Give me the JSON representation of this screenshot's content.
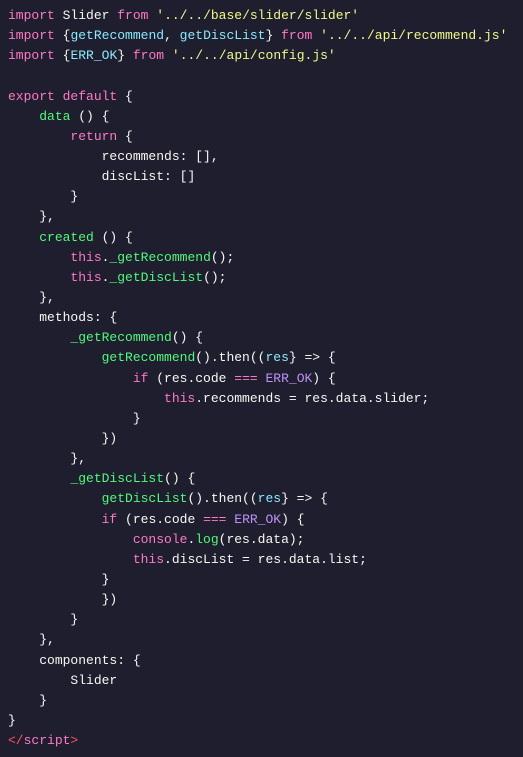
{
  "code": {
    "lines": [
      {
        "id": 1,
        "tokens": [
          {
            "t": "import-kw",
            "v": "import"
          },
          {
            "t": "plain",
            "v": " Slider "
          },
          {
            "t": "from-kw",
            "v": "from"
          },
          {
            "t": "plain",
            "v": " "
          },
          {
            "t": "string",
            "v": "'../../base/slider/slider'"
          }
        ]
      },
      {
        "id": 2,
        "tokens": [
          {
            "t": "import-kw",
            "v": "import"
          },
          {
            "t": "plain",
            "v": " "
          },
          {
            "t": "brace",
            "v": "{"
          },
          {
            "t": "cyan",
            "v": "getRecommend"
          },
          {
            "t": "plain",
            "v": ", "
          },
          {
            "t": "cyan",
            "v": "getDiscList"
          },
          {
            "t": "brace",
            "v": "}"
          },
          {
            "t": "plain",
            "v": " "
          },
          {
            "t": "from-kw",
            "v": "from"
          },
          {
            "t": "plain",
            "v": " "
          },
          {
            "t": "string",
            "v": "'../../api/recommend.js'"
          }
        ]
      },
      {
        "id": 3,
        "tokens": [
          {
            "t": "import-kw",
            "v": "import"
          },
          {
            "t": "plain",
            "v": " "
          },
          {
            "t": "brace",
            "v": "{"
          },
          {
            "t": "cyan",
            "v": "ERR_OK"
          },
          {
            "t": "brace",
            "v": "}"
          },
          {
            "t": "plain",
            "v": " "
          },
          {
            "t": "from-kw",
            "v": "from"
          },
          {
            "t": "plain",
            "v": " "
          },
          {
            "t": "string",
            "v": "'../../api/config.js'"
          }
        ]
      },
      {
        "id": 4,
        "tokens": []
      },
      {
        "id": 5,
        "tokens": [
          {
            "t": "keyword",
            "v": "export"
          },
          {
            "t": "plain",
            "v": " "
          },
          {
            "t": "keyword",
            "v": "default"
          },
          {
            "t": "plain",
            "v": " "
          },
          {
            "t": "brace",
            "v": "{"
          }
        ]
      },
      {
        "id": 6,
        "tokens": [
          {
            "t": "plain",
            "v": "    "
          },
          {
            "t": "func-name",
            "v": "data"
          },
          {
            "t": "plain",
            "v": " () "
          },
          {
            "t": "brace",
            "v": "{"
          }
        ]
      },
      {
        "id": 7,
        "tokens": [
          {
            "t": "plain",
            "v": "        "
          },
          {
            "t": "keyword",
            "v": "return"
          },
          {
            "t": "plain",
            "v": " "
          },
          {
            "t": "brace",
            "v": "{"
          }
        ]
      },
      {
        "id": 8,
        "tokens": [
          {
            "t": "plain",
            "v": "            "
          },
          {
            "t": "plain",
            "v": "recommends: "
          },
          {
            "t": "brace",
            "v": "[]"
          },
          {
            "t": "plain",
            "v": ","
          }
        ]
      },
      {
        "id": 9,
        "tokens": [
          {
            "t": "plain",
            "v": "            "
          },
          {
            "t": "plain",
            "v": "discList: "
          },
          {
            "t": "brace",
            "v": "[]"
          }
        ]
      },
      {
        "id": 10,
        "tokens": [
          {
            "t": "plain",
            "v": "        "
          },
          {
            "t": "brace",
            "v": "}"
          }
        ]
      },
      {
        "id": 11,
        "tokens": [
          {
            "t": "plain",
            "v": "    "
          },
          {
            "t": "brace",
            "v": "},"
          }
        ]
      },
      {
        "id": 12,
        "tokens": [
          {
            "t": "plain",
            "v": "    "
          },
          {
            "t": "func-name",
            "v": "created"
          },
          {
            "t": "plain",
            "v": " () "
          },
          {
            "t": "brace",
            "v": "{"
          }
        ]
      },
      {
        "id": 13,
        "tokens": [
          {
            "t": "plain",
            "v": "        "
          },
          {
            "t": "this-kw",
            "v": "this"
          },
          {
            "t": "plain",
            "v": "."
          },
          {
            "t": "method-call",
            "v": "_getRecommend"
          },
          {
            "t": "plain",
            "v": "();"
          }
        ]
      },
      {
        "id": 14,
        "tokens": [
          {
            "t": "plain",
            "v": "        "
          },
          {
            "t": "this-kw",
            "v": "this"
          },
          {
            "t": "plain",
            "v": "."
          },
          {
            "t": "method-call",
            "v": "_getDiscList"
          },
          {
            "t": "plain",
            "v": "();"
          }
        ]
      },
      {
        "id": 15,
        "tokens": [
          {
            "t": "plain",
            "v": "    "
          },
          {
            "t": "brace",
            "v": "},"
          }
        ]
      },
      {
        "id": 16,
        "tokens": [
          {
            "t": "plain",
            "v": "    "
          },
          {
            "t": "plain",
            "v": "methods: "
          },
          {
            "t": "brace",
            "v": "{"
          }
        ]
      },
      {
        "id": 17,
        "tokens": [
          {
            "t": "plain",
            "v": "        "
          },
          {
            "t": "func-name",
            "v": "_getRecommend"
          },
          {
            "t": "plain",
            "v": "() "
          },
          {
            "t": "brace",
            "v": "{"
          }
        ]
      },
      {
        "id": 18,
        "tokens": [
          {
            "t": "plain",
            "v": "            "
          },
          {
            "t": "method-call",
            "v": "getRecommend"
          },
          {
            "t": "plain",
            "v": "().then(("
          },
          {
            "t": "cyan",
            "v": "res"
          },
          {
            "t": "plain",
            "v": "} => "
          },
          {
            "t": "brace",
            "v": "{"
          }
        ]
      },
      {
        "id": 19,
        "tokens": [
          {
            "t": "plain",
            "v": "                "
          },
          {
            "t": "keyword",
            "v": "if"
          },
          {
            "t": "plain",
            "v": " (res.code "
          },
          {
            "t": "operator",
            "v": "==="
          },
          {
            "t": "plain",
            "v": " "
          },
          {
            "t": "const-val",
            "v": "ERR_OK"
          },
          {
            "t": "plain",
            "v": ") "
          },
          {
            "t": "brace",
            "v": "{"
          }
        ]
      },
      {
        "id": 20,
        "tokens": [
          {
            "t": "plain",
            "v": "                    "
          },
          {
            "t": "this-kw",
            "v": "this"
          },
          {
            "t": "plain",
            "v": ".recommends = res.data.slider;"
          }
        ]
      },
      {
        "id": 21,
        "tokens": [
          {
            "t": "plain",
            "v": "                "
          },
          {
            "t": "brace",
            "v": "}"
          }
        ]
      },
      {
        "id": 22,
        "tokens": [
          {
            "t": "plain",
            "v": "            "
          },
          {
            "t": "brace",
            "v": "})"
          }
        ]
      },
      {
        "id": 23,
        "tokens": [
          {
            "t": "plain",
            "v": "        "
          },
          {
            "t": "brace",
            "v": "},"
          }
        ]
      },
      {
        "id": 24,
        "tokens": [
          {
            "t": "plain",
            "v": "        "
          },
          {
            "t": "func-name",
            "v": "_getDiscList"
          },
          {
            "t": "plain",
            "v": "() "
          },
          {
            "t": "brace",
            "v": "{"
          }
        ]
      },
      {
        "id": 25,
        "tokens": [
          {
            "t": "plain",
            "v": "            "
          },
          {
            "t": "method-call",
            "v": "getDiscList"
          },
          {
            "t": "plain",
            "v": "().then(("
          },
          {
            "t": "cyan",
            "v": "res"
          },
          {
            "t": "plain",
            "v": "} => "
          },
          {
            "t": "brace",
            "v": "{"
          }
        ]
      },
      {
        "id": 26,
        "tokens": [
          {
            "t": "plain",
            "v": "            "
          },
          {
            "t": "keyword",
            "v": "if"
          },
          {
            "t": "plain",
            "v": " (res.code "
          },
          {
            "t": "operator",
            "v": "==="
          },
          {
            "t": "plain",
            "v": " "
          },
          {
            "t": "const-val",
            "v": "ERR_OK"
          },
          {
            "t": "plain",
            "v": ") "
          },
          {
            "t": "brace",
            "v": "{"
          }
        ]
      },
      {
        "id": 27,
        "tokens": [
          {
            "t": "plain",
            "v": "                "
          },
          {
            "t": "this-kw",
            "v": "console"
          },
          {
            "t": "plain",
            "v": "."
          },
          {
            "t": "method-call",
            "v": "log"
          },
          {
            "t": "plain",
            "v": "(res.data);"
          }
        ]
      },
      {
        "id": 28,
        "tokens": [
          {
            "t": "plain",
            "v": "                "
          },
          {
            "t": "this-kw",
            "v": "this"
          },
          {
            "t": "plain",
            "v": ".discList = res.data.list;"
          }
        ]
      },
      {
        "id": 29,
        "tokens": [
          {
            "t": "plain",
            "v": "            "
          },
          {
            "t": "brace",
            "v": "}"
          }
        ]
      },
      {
        "id": 30,
        "tokens": [
          {
            "t": "plain",
            "v": "            "
          },
          {
            "t": "brace",
            "v": "})"
          }
        ]
      },
      {
        "id": 31,
        "tokens": [
          {
            "t": "plain",
            "v": "        "
          },
          {
            "t": "brace",
            "v": "}"
          }
        ]
      },
      {
        "id": 32,
        "tokens": [
          {
            "t": "plain",
            "v": "    "
          },
          {
            "t": "brace",
            "v": "},"
          }
        ]
      },
      {
        "id": 33,
        "tokens": [
          {
            "t": "plain",
            "v": "    "
          },
          {
            "t": "plain",
            "v": "components: "
          },
          {
            "t": "brace",
            "v": "{"
          }
        ]
      },
      {
        "id": 34,
        "tokens": [
          {
            "t": "plain",
            "v": "        "
          },
          {
            "t": "plain",
            "v": "Slider"
          }
        ]
      },
      {
        "id": 35,
        "tokens": [
          {
            "t": "plain",
            "v": "    "
          },
          {
            "t": "brace",
            "v": "}"
          }
        ]
      },
      {
        "id": 36,
        "tokens": [
          {
            "t": "brace",
            "v": "}"
          }
        ]
      },
      {
        "id": 37,
        "tokens": [
          {
            "t": "tag",
            "v": "</"
          },
          {
            "t": "tag-name",
            "v": "script"
          },
          {
            "t": "tag",
            "v": ">"
          }
        ]
      }
    ]
  }
}
